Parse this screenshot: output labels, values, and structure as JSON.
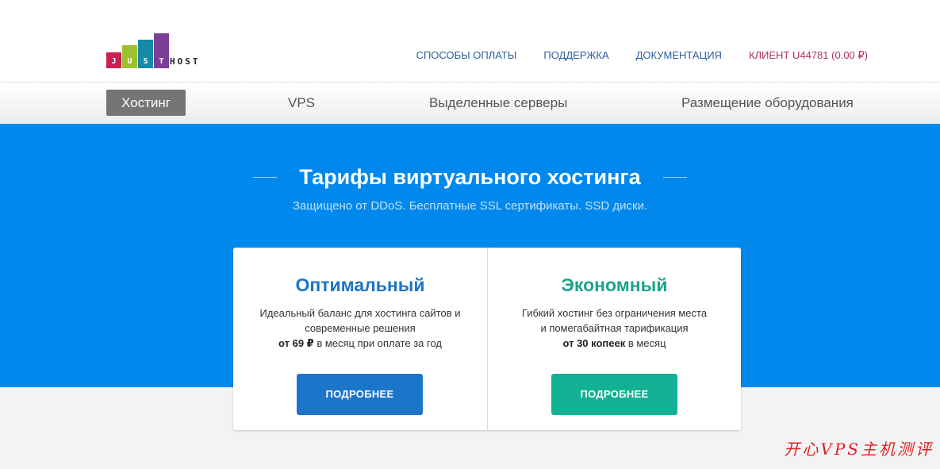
{
  "logo": {
    "letters": [
      "J",
      "U",
      "S",
      "T"
    ],
    "host_text": "HOST",
    "bar_colors": [
      "#c8214f",
      "#9dc02e",
      "#158aa8",
      "#7b3f98"
    ]
  },
  "top_nav": {
    "payment": "Способы оплаты",
    "support": "Поддержка",
    "docs": "Документация",
    "client": "КЛИЕНТ U44781 (0.00 ₽)"
  },
  "sub_nav": {
    "hosting": "Хостинг",
    "vps": "VPS",
    "dedicated": "Выделенные серверы",
    "colocation": "Размещение оборудования"
  },
  "hero": {
    "title": "Тарифы виртуального хостинга",
    "subtitle": "Защищено от DDoS. Бесплатные SSL сертификаты. SSD диски."
  },
  "plans": [
    {
      "title": "Оптимальный",
      "desc_line1": "Идеальный баланс для хостинга сайтов и",
      "desc_line2": "современные решения",
      "price_bold": "от 69 ₽",
      "price_rest": " в месяц при оплате за год",
      "button": "ПОДРОБНЕЕ"
    },
    {
      "title": "Экономный",
      "desc_line1": "Гибкий хостинг без ограничения места",
      "desc_line2": "и помегабайтная тарификация",
      "price_bold": "от 30 копеек",
      "price_rest": " в месяц",
      "button": "ПОДРОБНЕЕ"
    }
  ],
  "watermark": "开心VPS主机测评",
  "colors": {
    "hero_bg": "#0088ec",
    "plan1_accent": "#1b75c9",
    "plan2_accent": "#13b193",
    "client_link": "#b2325d",
    "nav_link": "#2a5d9f"
  }
}
